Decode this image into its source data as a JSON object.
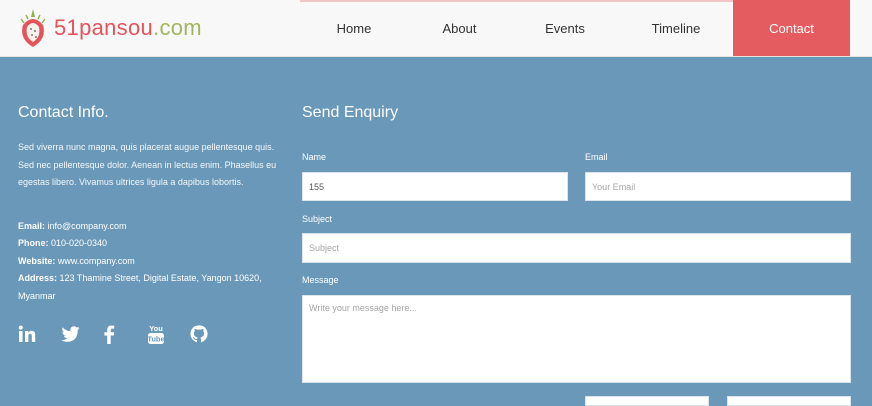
{
  "header": {
    "logo": {
      "num": "51",
      "name": "pansou",
      "domain": ".com"
    },
    "nav": [
      {
        "label": "Home",
        "active": false
      },
      {
        "label": "About",
        "active": false
      },
      {
        "label": "Events",
        "active": false
      },
      {
        "label": "Timeline",
        "active": false
      },
      {
        "label": "Contact",
        "active": true
      }
    ]
  },
  "contact": {
    "title": "Contact Info.",
    "description": "Sed viverra nunc magna, quis placerat augue pellentesque quis. Sed nec pellentesque dolor. Aenean in lectus enim. Phasellus eu egestas libero. Vivamus ultrices ligula a dapibus lobortis.",
    "email_label": "Email:",
    "email": "info@company.com",
    "phone_label": "Phone:",
    "phone": "010-020-0340",
    "website_label": "Website:",
    "website": "www.company.com",
    "address_label": "Address:",
    "address": "123 Thamine Street, Digital Estate, Yangon 10620, Myanmar",
    "social": [
      "linkedin-icon",
      "twitter-icon",
      "facebook-icon",
      "youtube-icon",
      "github-icon"
    ]
  },
  "enquiry": {
    "title": "Send Enquiry",
    "name_label": "Name",
    "name_value": "155",
    "email_label": "Email",
    "email_placeholder": "Your Email",
    "subject_label": "Subject",
    "subject_placeholder": "Subject",
    "message_label": "Message",
    "message_placeholder": "Write your message here..."
  },
  "colors": {
    "background": "#6a98b8",
    "accent": "#e45b60",
    "header": "#f8f8f8"
  }
}
